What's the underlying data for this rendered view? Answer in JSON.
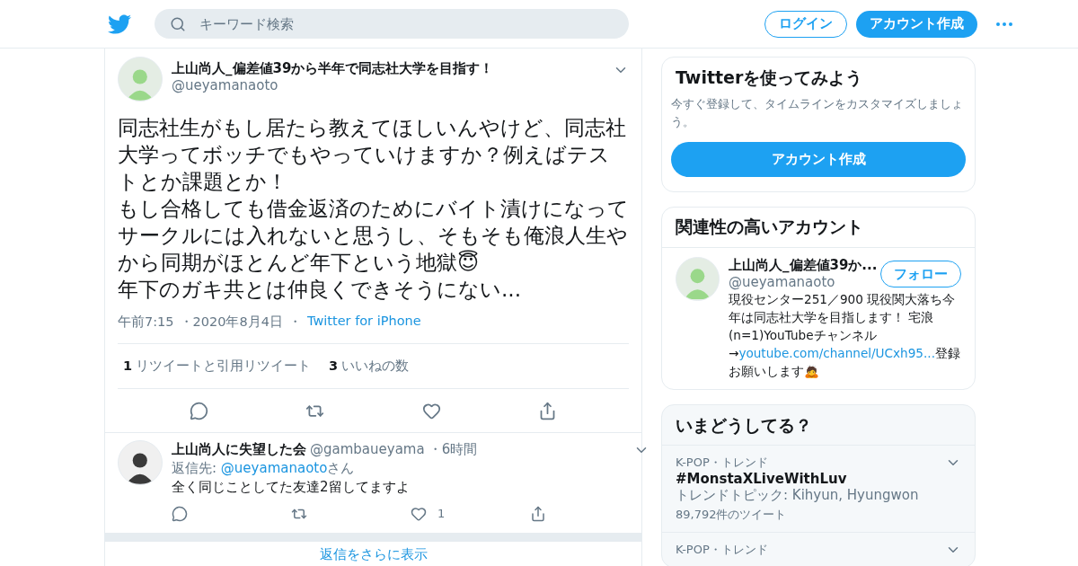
{
  "header": {
    "search": {
      "placeholder": "キーワード検索"
    },
    "login": "ログイン",
    "signup": "アカウント作成"
  },
  "tweet": {
    "name": "上山尚人_偏差値39から半年で同志社大学を目指す！",
    "handle": "@ueyamanaoto",
    "paragraphs": [
      "同志社生がもし居たら教えてほしいんやけど、同志社大学ってボッチでもやっていけますか？例えばテストとか課題とか！",
      "もし合格しても借金返済のためにバイト漬けになってサークルには入れないと思うし、そもそも俺浪人生やから同期がほとんど年下という地獄😇",
      "年下のガキ共とは仲良くできそうにない..."
    ],
    "time": "午前7:15",
    "date": "・2020年8月4日",
    "source_prefix": "・",
    "source": "Twitter for iPhone",
    "stats": [
      {
        "count": "1",
        "label": "リツイートと引用リツイート"
      },
      {
        "count": "3",
        "label": "いいねの数"
      }
    ]
  },
  "replies": [
    {
      "name": "上山尚人に失望した会",
      "handle": "@gambaueyama",
      "age": "・6時間",
      "reply_to_prefix": "返信先: ",
      "reply_to": "@ueyamanaoto",
      "reply_to_suffix": "さん",
      "text": "全く同じことしてた友達2留してますよ",
      "like_count": "1"
    }
  ],
  "show_more": "返信をさらに表示",
  "signup_card": {
    "title": "Twitterを使ってみよう",
    "text": "今すぐ登録して、タイムラインをカスタマイズしましょう。",
    "button": "アカウント作成"
  },
  "related": {
    "title": "関連性の高いアカウント",
    "accounts": [
      {
        "name": "上山尚人_偏差値39か...",
        "handle": "@ueyamanaoto",
        "follow": "フォロー",
        "bio_before": "現役センター251／900 現役関大落ち今年は同志社大学を目指します！ 宅浪(n=1)YouTubeチャンネル→",
        "bio_link": "youtube.com/channel/UCxh95...",
        "bio_after": "登録お願いします🙇"
      }
    ]
  },
  "trends": {
    "title": "いまどうしてる？",
    "items": [
      {
        "category": "K-POP・トレンド",
        "name": "#MonstaXLiveWithLuv",
        "topic": "トレンドトピック: Kihyun, Hyungwon",
        "count": "89,792件のツイート"
      },
      {
        "category": "K-POP・トレンド"
      }
    ]
  }
}
